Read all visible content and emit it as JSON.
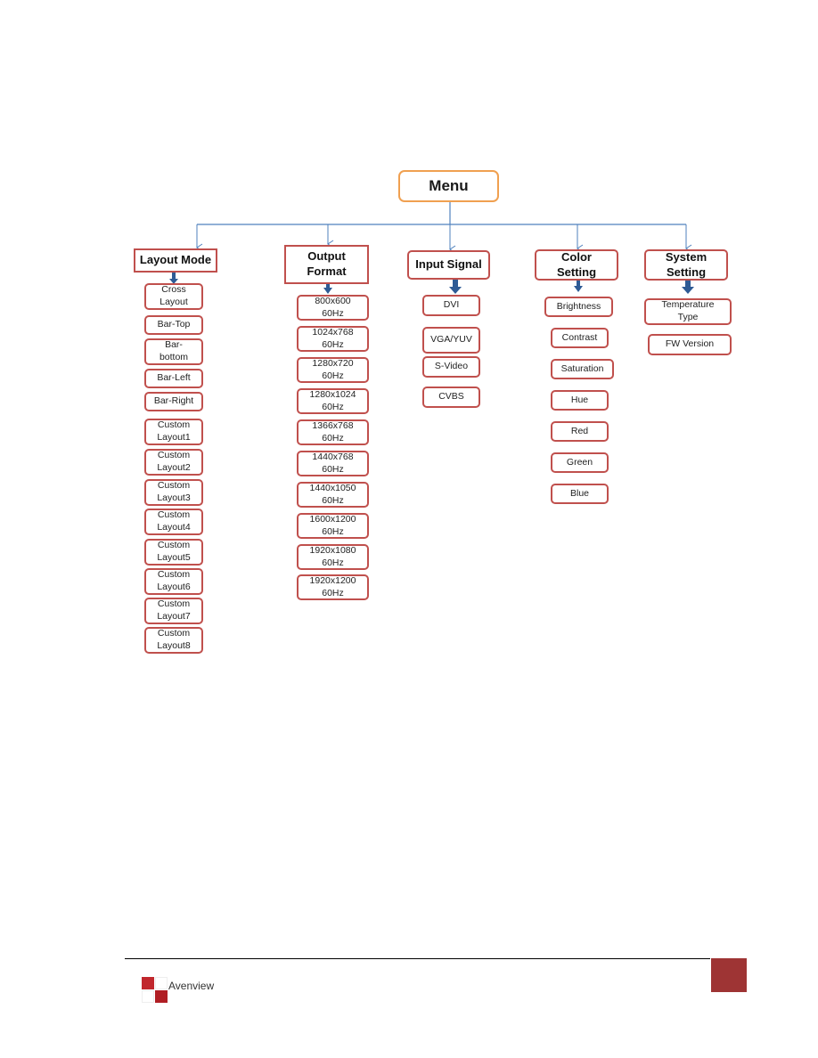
{
  "diagram": {
    "root": "Menu",
    "categories": [
      {
        "id": "layout-mode",
        "label": "Layout Mode",
        "items": [
          "Cross\nLayout",
          "Bar-Top",
          "Bar-\nbottom",
          "Bar-Left",
          "Bar-Right",
          "Custom\nLayout1",
          "Custom\nLayout2",
          "Custom\nLayout3",
          "Custom\nLayout4",
          "Custom\nLayout5",
          "Custom\nLayout6",
          "Custom\nLayout7",
          "Custom\nLayout8"
        ]
      },
      {
        "id": "output-format",
        "label": "Output\nFormat",
        "items": [
          "800x600\n60Hz",
          "1024x768\n60Hz",
          "1280x720\n60Hz",
          "1280x1024\n60Hz",
          "1366x768\n60Hz",
          "1440x768\n60Hz",
          "1440x1050\n60Hz",
          "1600x1200\n60Hz",
          "1920x1080\n60Hz",
          "1920x1200\n60Hz"
        ]
      },
      {
        "id": "input-signal",
        "label": "Input Signal",
        "items": [
          "DVI",
          "VGA/YUV",
          "S-Video",
          "CVBS"
        ]
      },
      {
        "id": "color-setting",
        "label": "Color\nSetting",
        "items": [
          "Brightness",
          "Contrast",
          "Saturation",
          "Hue",
          "Red",
          "Green",
          "Blue"
        ]
      },
      {
        "id": "system-setting",
        "label": "System\nSetting",
        "items": [
          "Temperature\nType",
          "FW Version"
        ]
      }
    ]
  },
  "footer": {
    "brand": "Avenview"
  },
  "colors": {
    "root_border": "#f0a050",
    "box_border": "#c0504d",
    "connector": "#4f81bd",
    "arrow": "#2e5b95",
    "page_square": "#9e3434"
  }
}
